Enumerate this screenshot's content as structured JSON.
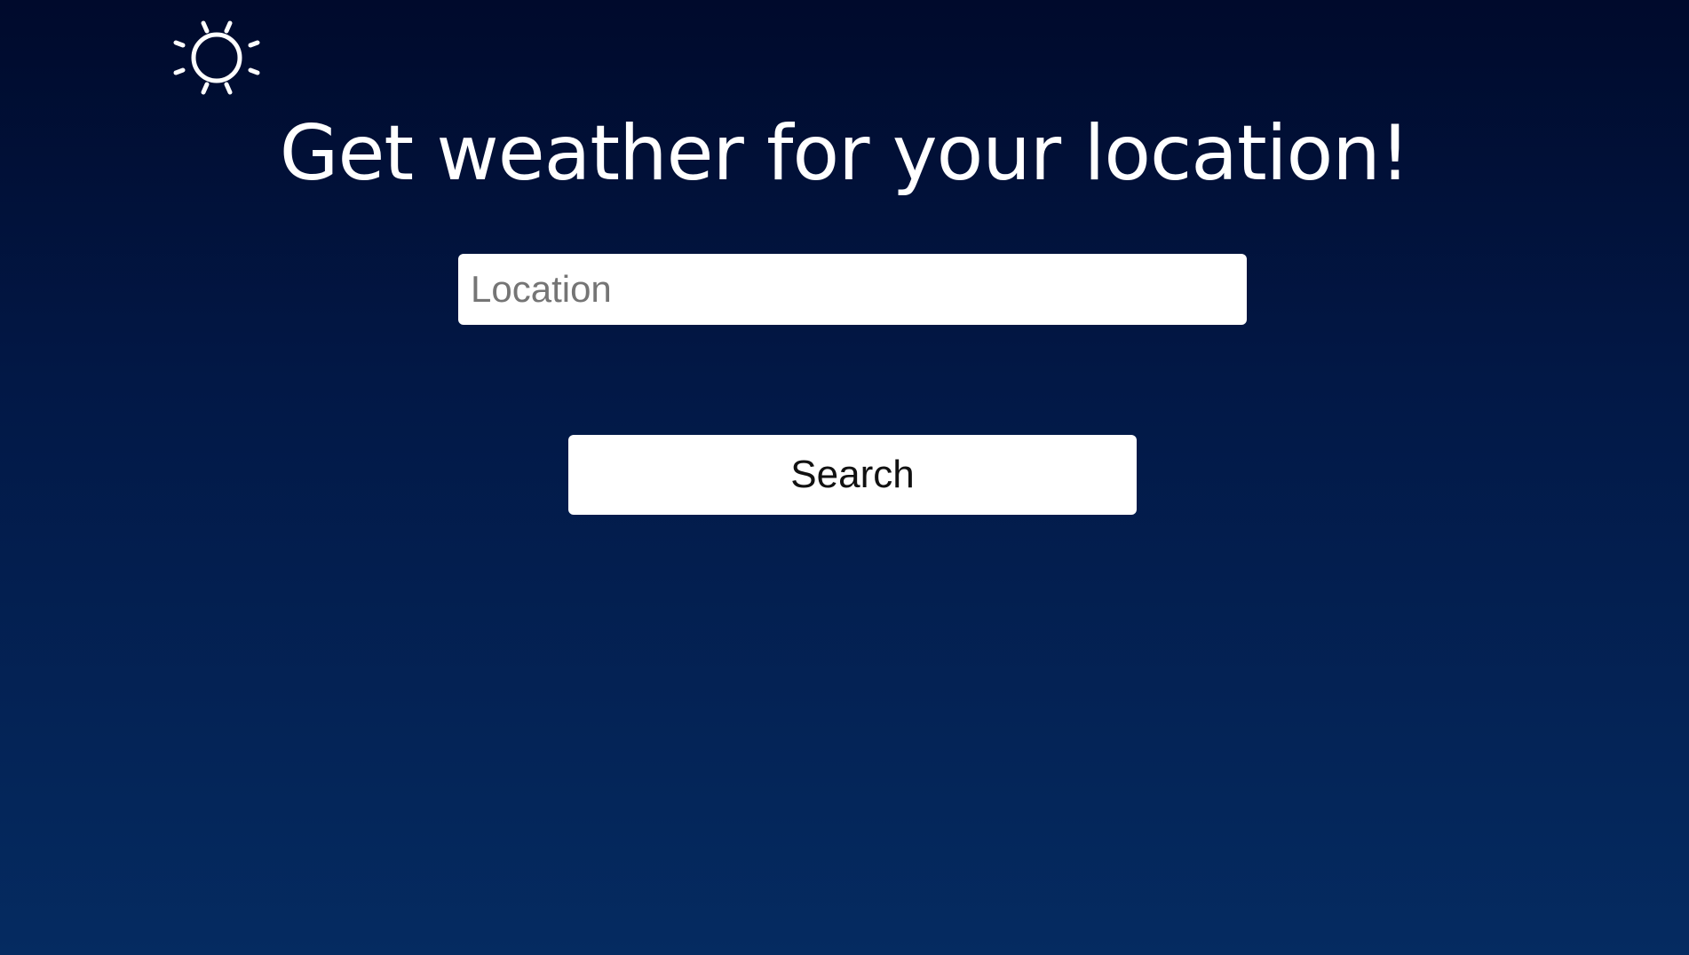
{
  "header": {
    "logo_icon": "sun-icon"
  },
  "main": {
    "title": "Get weather for your location!",
    "location_input": {
      "placeholder": "Location",
      "value": ""
    },
    "search_button_label": "Search"
  },
  "colors": {
    "background_top": "#000a2c",
    "background_bottom": "#052b61",
    "text": "#ffffff",
    "input_background": "#ffffff",
    "button_background": "#ffffff"
  }
}
